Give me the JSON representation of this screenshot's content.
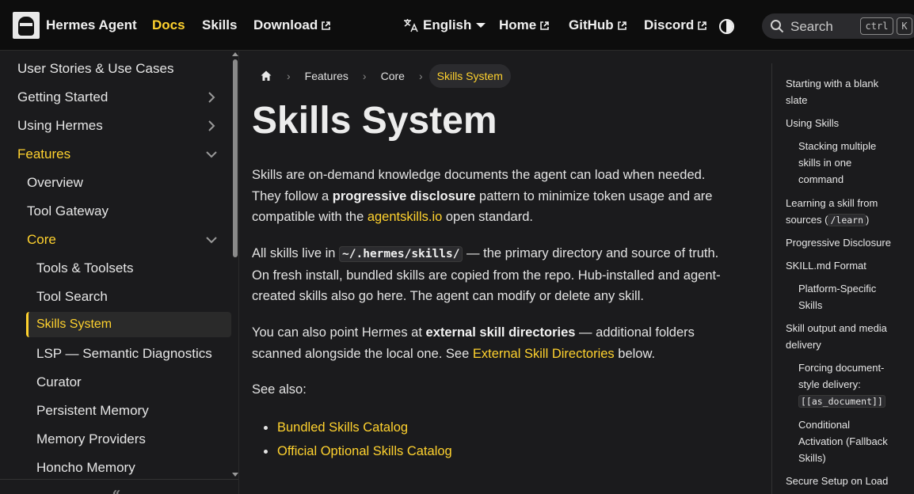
{
  "navbar": {
    "brand_title": "Hermes Agent",
    "links": [
      {
        "label": "Docs",
        "active": true
      },
      {
        "label": "Skills"
      },
      {
        "label": "Download"
      },
      {
        "label": "English"
      },
      {
        "label": "Home"
      },
      {
        "label": "GitHub"
      },
      {
        "label": "Discord"
      }
    ],
    "search_placeholder": "Search",
    "kbd_ctrl": "ctrl",
    "kbd_k": "K",
    "accent_color": "#ffd22e"
  },
  "sidebar": {
    "items": [
      {
        "label": "User Stories & Use Cases"
      },
      {
        "label": "Getting Started"
      },
      {
        "label": "Using Hermes"
      },
      {
        "label": "Features"
      },
      {
        "label": "Overview"
      },
      {
        "label": "Tool Gateway"
      },
      {
        "label": "Core"
      },
      {
        "label": "Tools & Toolsets"
      },
      {
        "label": "Tool Search"
      },
      {
        "label": "Skills System"
      },
      {
        "label": "LSP — Semantic Diagnostics"
      },
      {
        "label": "Curator"
      },
      {
        "label": "Persistent Memory"
      },
      {
        "label": "Memory Providers"
      },
      {
        "label": "Honcho Memory"
      }
    ],
    "collapse_glyph": "«"
  },
  "breadcrumb": {
    "items": [
      "Features",
      "Core",
      "Skills System"
    ],
    "separator": "›"
  },
  "main": {
    "title": "Skills System",
    "p1": {
      "t1": "Skills are on-demand knowledge documents the agent can load when needed.",
      "t2": "They follow a ",
      "bold": "progressive disclosure",
      "t3": " pattern to minimize token usage and are",
      "t4": "compatible with the ",
      "link": "agentskills.io",
      "t5": " open standard."
    },
    "p2": {
      "t1": "All skills live in ",
      "code": "~/.hermes/skills/",
      "t2": " — the primary directory and source of truth.",
      "t3": "On fresh install, bundled skills are copied from the repo. Hub-installed and agent-",
      "t4": "created skills also go here. The agent can modify or delete any skill."
    },
    "p3": {
      "t1": "You can also point Hermes at ",
      "bold": "external skill directories",
      "t2": " — additional folders",
      "t3": "scanned alongside the local one. See ",
      "link": "External Skill Directories",
      "t4": " below."
    },
    "see_also": "See also:",
    "bullets": [
      "Bundled Skills Catalog",
      "Official Optional Skills Catalog"
    ]
  },
  "toc": {
    "items": [
      {
        "l1": "Starting with a blank",
        "l2": "slate"
      },
      {
        "l1": "Using Skills"
      },
      {
        "l1": "Stacking multiple",
        "l2": "skills in one",
        "l3": "command"
      },
      {
        "l1": "Learning a skill from",
        "l2a": "sources (",
        "code": "/learn",
        "l2b": ")"
      },
      {
        "l1": "Progressive Disclosure"
      },
      {
        "l1": "SKILL.md Format"
      },
      {
        "l1": "Platform-Specific",
        "l2": "Skills"
      },
      {
        "l1": "Skill output and media",
        "l2": "delivery"
      },
      {
        "l1": "Forcing document-",
        "l2": "style delivery:",
        "code": "[[as_document]]"
      },
      {
        "l1": "Conditional",
        "l2": "Activation (Fallback",
        "l3": "Skills)"
      },
      {
        "l1": "Secure Setup on Load"
      }
    ]
  }
}
